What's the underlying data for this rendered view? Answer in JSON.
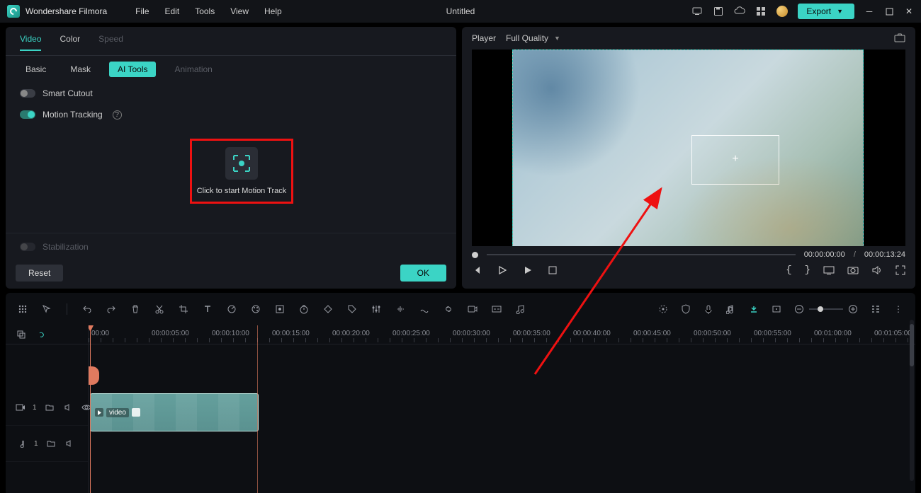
{
  "app_name": "Wondershare Filmora",
  "menu": {
    "file": "File",
    "edit": "Edit",
    "tools": "Tools",
    "view": "View",
    "help": "Help"
  },
  "doc_title": "Untitled",
  "export_label": "Export",
  "left": {
    "tabs": {
      "video": "Video",
      "color": "Color",
      "speed": "Speed"
    },
    "subtabs": {
      "basic": "Basic",
      "mask": "Mask",
      "aitools": "AI Tools",
      "animation": "Animation"
    },
    "smart_cutout": "Smart Cutout",
    "motion_tracking": "Motion Tracking",
    "motion_start": "Click to start Motion Track",
    "stabilization": "Stabilization",
    "reset": "Reset",
    "ok": "OK"
  },
  "player": {
    "label": "Player",
    "quality": "Full Quality",
    "cur": "00:00:00:00",
    "dur": "00:00:13:24"
  },
  "ruler": [
    "00:00",
    "00:00:05:00",
    "00:00:10:00",
    "00:00:15:00",
    "00:00:20:00",
    "00:00:25:00",
    "00:00:30:00",
    "00:00:35:00",
    "00:00:40:00",
    "00:00:45:00",
    "00:00:50:00",
    "00:00:55:00",
    "00:01:00:00",
    "00:01:05:00"
  ],
  "track": {
    "video": "1",
    "audio": "1",
    "clip_name": "video"
  }
}
